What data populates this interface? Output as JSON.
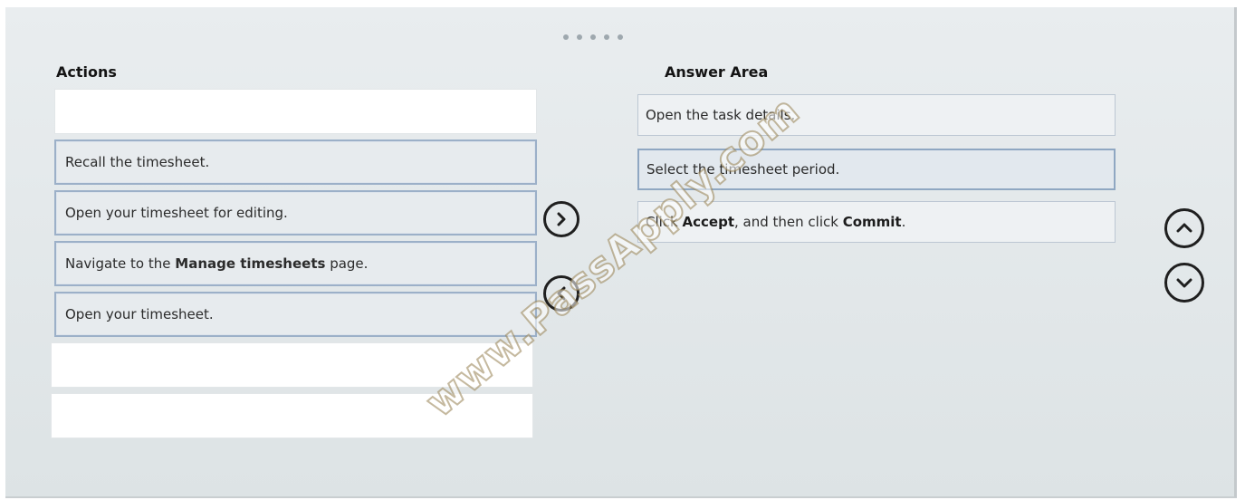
{
  "actions": {
    "heading": "Actions",
    "slots": [
      {
        "label": ""
      },
      {
        "label": "Recall the timesheet."
      },
      {
        "label": "Open your timesheet for editing."
      },
      {
        "label_pre": "Navigate to the ",
        "label_bold": "Manage timesheets",
        "label_post": " page."
      },
      {
        "label": "Open your timesheet."
      },
      {
        "label": ""
      },
      {
        "label": ""
      }
    ]
  },
  "answer_area": {
    "heading": "Answer Area",
    "items": [
      {
        "label": "Open the task details."
      },
      {
        "label": "Select the timesheet period."
      },
      {
        "label_pre": "Click ",
        "label_bold1": "Accept",
        "label_mid": ", and then click ",
        "label_bold2": "Commit",
        "label_post": "."
      }
    ]
  },
  "controls": {
    "move_right_icon": "chevron-right-icon",
    "move_left_icon": "chevron-left-icon",
    "move_up_icon": "chevron-up-icon",
    "move_down_icon": "chevron-down-icon"
  },
  "pager": {
    "dots": 5
  },
  "watermark": "www.PassApply.com",
  "colors": {
    "item_border": "#9cb0c8",
    "selected_border": "#8fa7c2",
    "button_stroke": "#1f1f1f"
  }
}
